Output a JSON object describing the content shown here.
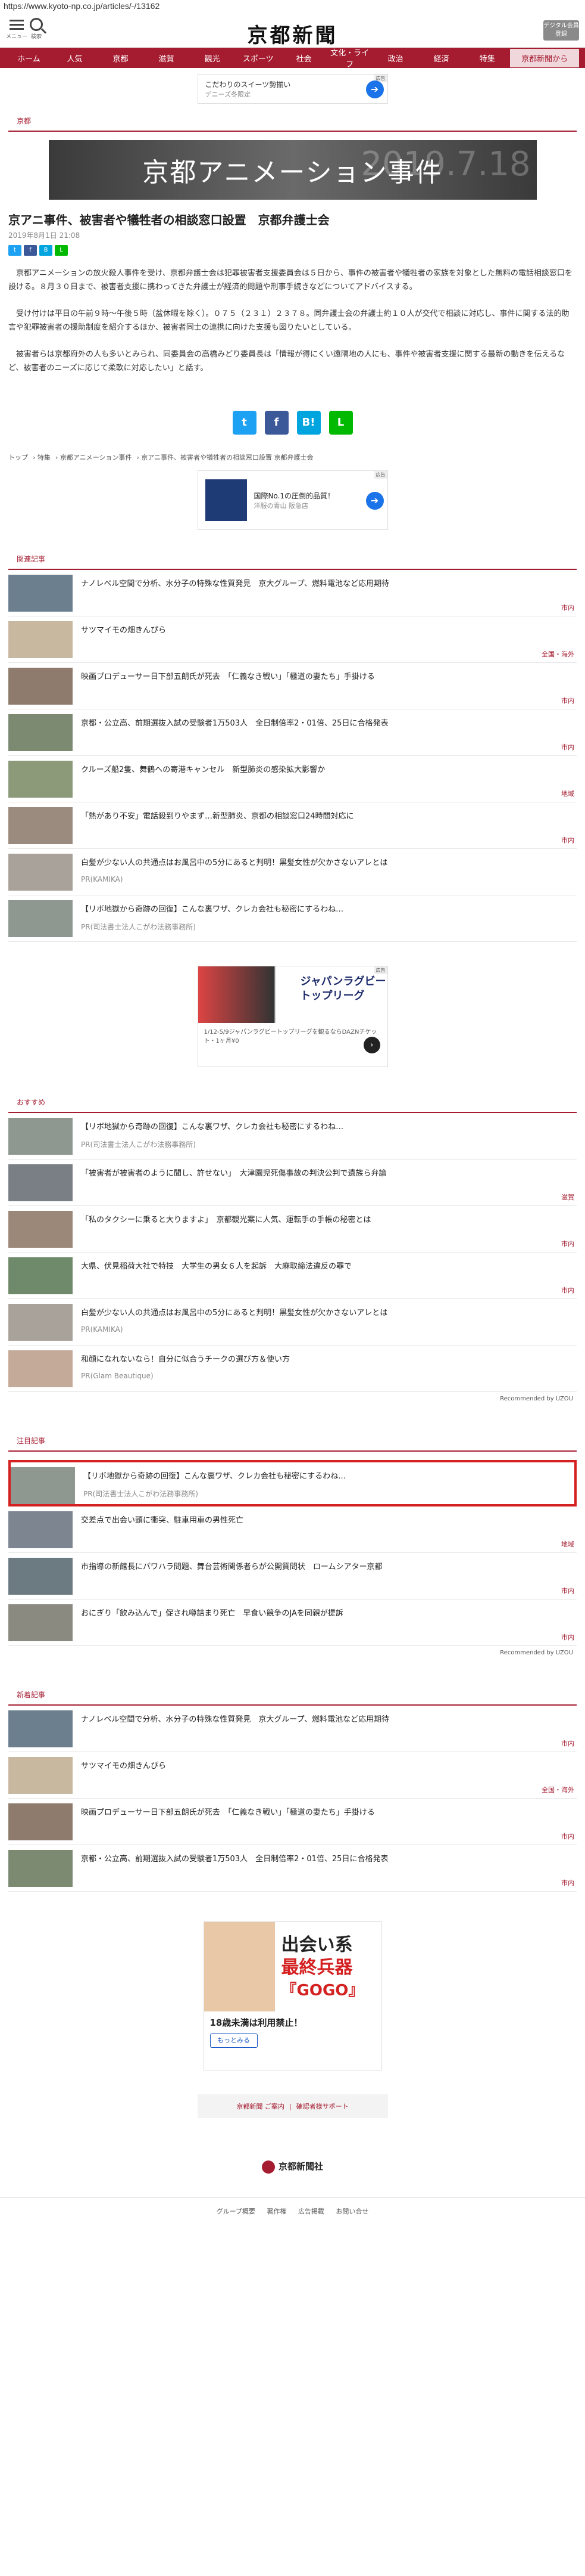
{
  "url": "https://www.kyoto-np.co.jp/articles/-/13162",
  "header": {
    "menu_label": "メニュー",
    "search_label": "検索",
    "logo": "京都新聞",
    "digital_label": "デジタル会員登録"
  },
  "nav": [
    "ホーム",
    "人気",
    "京都",
    "滋賀",
    "観光",
    "スポーツ",
    "社会",
    "文化・ライフ",
    "政治",
    "経済",
    "特集",
    "京都新聞から"
  ],
  "ad_top": {
    "line1": "こだわりのスイーツ勢揃い",
    "line2": "デニーズ冬限定",
    "tag": "広告"
  },
  "section_kyoto": "京都",
  "banner": {
    "text": "京都アニメーション事件",
    "watermark": "2019.7.18"
  },
  "article": {
    "title": "京アニ事件、被害者や犠牲者の相談窓口設置　京都弁護士会",
    "date": "2019年8月1日 21:08",
    "p1": "京都アニメーションの放火殺人事件を受け、京都弁護士会は犯罪被害者支援委員会は５日から、事件の被害者や犠牲者の家族を対象とした無料の電話相談窓口を設ける。８月３０日まで、被害者支援に携わってきた弁護士が経済的問題や刑事手続きなどについてアドバイスする。",
    "p2": "受け付けは平日の午前９時～午後５時（盆休暇を除く）。０７５（２３１）２３７８。同弁護士会の弁護士約１０人が交代で相談に対応し、事件に関する法的助言や犯罪被害者の援助制度を紹介するほか、被害者同士の連携に向けた支援も図りたいとしている。",
    "p3": "被害者らは京都府外の人も多いとみられ、同委員会の高橋みどり委員長は「情報が得にくい遠隔地の人にも、事件や被害者支援に関する最新の動きを伝えるなど、被害者のニーズに応じて柔軟に対応したい」と話す。"
  },
  "breadcrumb": [
    "トップ",
    "特集",
    "京都アニメーション事件",
    "京アニ事件、被害者や犠牲者の相談窓口設置 京都弁護士会"
  ],
  "ad_mid": {
    "line1": "国際No.1の圧倒的品質！",
    "line2": "洋服の青山 阪急店",
    "tag": "広告"
  },
  "related_label": "関連記事",
  "related": [
    {
      "title": "ナノレベル空間で分析、水分子の特殊な性質発見　京大グループ、燃料電池など応用期待",
      "cat": "市内"
    },
    {
      "title": "サツマイモの畑きんぴら",
      "cat": "全国・海外"
    },
    {
      "title": "映画プロデューサー日下部五朗氏が死去　「仁義なき戦い」「極道の妻たち」手掛ける",
      "cat": "市内"
    },
    {
      "title": "京都・公立高、前期選抜入試の受験者1万503人　全日制倍率2・01倍、25日に合格発表",
      "cat": "市内"
    },
    {
      "title": "クルーズ船2隻、舞鶴への寄港キャンセル　新型肺炎の感染拡大影響か",
      "cat": "地域"
    },
    {
      "title": "「熱があり不安」電話殺到りやまず…新型肺炎、京都の相談窓口24時間対応に",
      "cat": "市内"
    },
    {
      "title": "白髪が少ない人の共通点はお風呂中の5分にあると判明！黒髪女性が欠かさないアレとは",
      "pr": "PR(KAMIKA)"
    },
    {
      "title": "【リボ地獄から奇跡の回復】こんな裏ワザ、クレカ会社も秘密にするわね…",
      "pr": "PR(司法書士法人こがわ法務事務所)"
    }
  ],
  "ad_rugby": {
    "title": "ジャパンラグビー トップリーグ",
    "text": "1/12-5/9ジャパンラグビートップリーグを観るならDAZNチケット・1ヶ月¥0",
    "tag": "広告"
  },
  "recommend_label": "おすすめ",
  "recommend": [
    {
      "title": "【リボ地獄から奇跡の回復】こんな裏ワザ、クレカ会社も秘密にするわね…",
      "pr": "PR(司法書士法人こがわ法務事務所)"
    },
    {
      "title": "「被害者が被害者のように聞し、許せない」　大津園児死傷事故の判決公判で遺族ら弁論",
      "cat": "滋賀"
    },
    {
      "title": "「私のタクシーに乗ると大りますよ」　京都観光案に人気、運転手の手帳の秘密とは",
      "cat": "市内"
    },
    {
      "title": "大県、伏見稲荷大社で特技　大学生の男女６人を起訴　大麻取締法違反の罪で",
      "cat": "市内"
    },
    {
      "title": "白髪が少ない人の共通点はお風呂中の5分にあると判明！黒髪女性が欠かさないアレとは",
      "pr": "PR(KAMIKA)"
    },
    {
      "title": "和顔になれないなら！自分に似合うチークの選び方＆使い方",
      "pr": "PR(Glam Beautique)"
    }
  ],
  "recommended_by": "Recommended by UZOU",
  "popular_label": "注目記事",
  "popular": [
    {
      "title": "【リボ地獄から奇跡の回復】こんな裏ワザ、クレカ会社も秘密にするわね…",
      "pr": "PR(司法書士法人こがわ法務事務所)"
    },
    {
      "title": "交差点で出会い頭に衝突、駐車用車の男性死亡",
      "cat": "地域"
    },
    {
      "title": "市指導の新館長にパワハラ問題、舞台芸術関係者らが公開質問状　ロームシアター京都",
      "cat": "市内"
    },
    {
      "title": "おにぎり「飲み込んで」促され噂詰まり死亡　早食い競争のJAを同親が提訴",
      "cat": "市内"
    }
  ],
  "new_label": "新着記事",
  "new": [
    {
      "title": "ナノレベル空間で分析、水分子の特殊な性質発見　京大グループ、燃料電池など応用期待",
      "cat": "市内"
    },
    {
      "title": "サツマイモの畑きんぴら",
      "cat": "全国・海外"
    },
    {
      "title": "映画プロデューサー日下部五朗氏が死去　「仁義なき戦い」「極道の妻たち」手掛ける",
      "cat": "市内"
    },
    {
      "title": "京都・公立高、前期選抜入試の受験者1万503人　全日制倍率2・01倍、25日に合格発表",
      "cat": "市内"
    }
  ],
  "ad_bottom": {
    "big1": "出会い系",
    "big2": "最終兵器",
    "brand": "『GOGO』",
    "title": "18歳未満は利用禁止！",
    "btn": "もっとみる"
  },
  "footer": {
    "link1": "京都新聞 ご案内",
    "link2": "確認者様サポート",
    "logo": "京都新聞社",
    "nav": [
      "グループ概要",
      "著作権",
      "広告掲載",
      "お問い合せ"
    ]
  }
}
